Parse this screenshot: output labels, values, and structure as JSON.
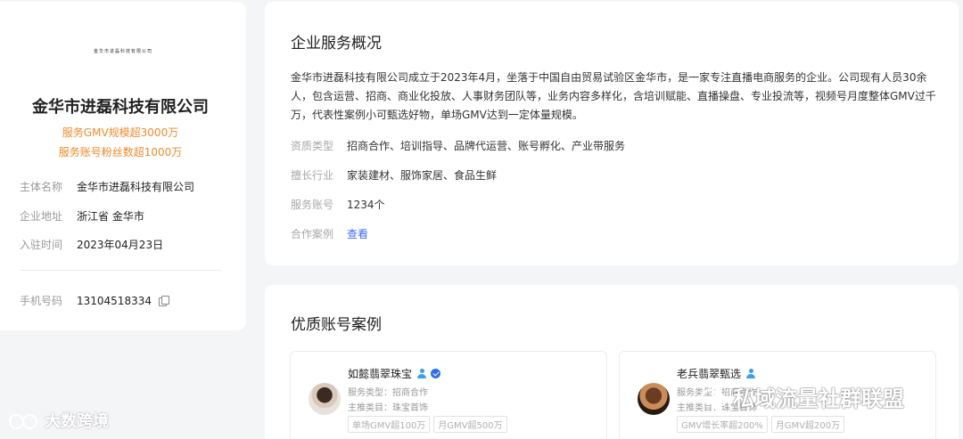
{
  "profile": {
    "logo_text": "金华市进磊科技有限公司",
    "company_name": "金华市进磊科技有限公司",
    "stats": [
      "服务GMV规模超3000万",
      "服务账号粉丝数超1000万"
    ],
    "info": [
      {
        "key": "主体名称",
        "value": "金华市进磊科技有限公司"
      },
      {
        "key": "企业地址",
        "value": "浙江省 金华市"
      },
      {
        "key": "入驻时间",
        "value": "2023年04月23日"
      }
    ],
    "phone": {
      "key": "手机号码",
      "value": "13104518334"
    }
  },
  "overview": {
    "title": "企业服务概况",
    "description": "金华市进磊科技有限公司成立于2023年4月，坐落于中国自由贸易试验区金华市，是一家专注直播电商服务的企业。公司现有人员30余人，包含运营、招商、商业化投放、人事财务团队等，业务内容多样化，含培训赋能、直播操盘、专业投流等，视频号月度整体GMV过千万，代表性案例小可甄选好物，单场GMV达到一定体量规模。",
    "attributes": [
      {
        "key": "资质类型",
        "value": "招商合作、培训指导、品牌代运营、账号孵化、产业带服务"
      },
      {
        "key": "擅长行业",
        "value": "家装建材、服饰家居、食品生鲜"
      },
      {
        "key": "服务账号",
        "value": "1234个"
      },
      {
        "key": "合作案例",
        "value": "查看"
      }
    ]
  },
  "cases": {
    "title": "优质账号案例",
    "items": [
      {
        "name": "如懿翡翠珠宝",
        "service_type": "服务类型：招商合作",
        "category": "主推类目：珠宝首饰",
        "tags": [
          "单场GMV超100万",
          "月GMV超500万"
        ]
      },
      {
        "name": "老兵翡翠甄选",
        "service_type": "服务类型：招商合作",
        "category": "主推类目：珠宝首饰",
        "tags": [
          "GMV增长率超200%",
          "月GMV超200万"
        ]
      }
    ]
  },
  "watermarks": {
    "left": "大数跨境",
    "right": "私域流量社群联盟"
  }
}
